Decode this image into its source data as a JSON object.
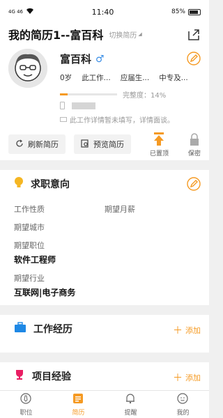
{
  "status_bar": {
    "left": "4G 46",
    "time": "11:40",
    "battery": "85%"
  },
  "header": {
    "title": "我的简历1--富百科",
    "switch_label": "切换简历"
  },
  "profile": {
    "name": "富百科",
    "gender_symbol": "♂",
    "age": "0岁",
    "work_years": "此工作...",
    "education": "应届生...",
    "degree": "中专及...",
    "completion_label": "完整度：14%",
    "completion_value": 14,
    "note": "此工作详情暂未填写，详情面谈。"
  },
  "actions": {
    "refresh": "刷新简历",
    "preview": "预览简历",
    "pinned": "已置顶",
    "private": "保密"
  },
  "intent": {
    "title": "求职意向",
    "job_nature_label": "工作性质",
    "salary_label": "期望月薪",
    "city_label": "期望城市",
    "position_label": "期望职位",
    "position_value": "软件工程师",
    "industry_label": "期望行业",
    "industry_value": "互联网|电子商务"
  },
  "work": {
    "title": "工作经历",
    "add": "添加"
  },
  "project": {
    "title": "项目经验",
    "add": "添加"
  },
  "tabs": [
    {
      "label": "职位"
    },
    {
      "label": "简历"
    },
    {
      "label": "提醒"
    },
    {
      "label": "我的"
    }
  ],
  "colors": {
    "accent": "#f59a23",
    "blue": "#1e88e5",
    "muted": "#999999"
  }
}
